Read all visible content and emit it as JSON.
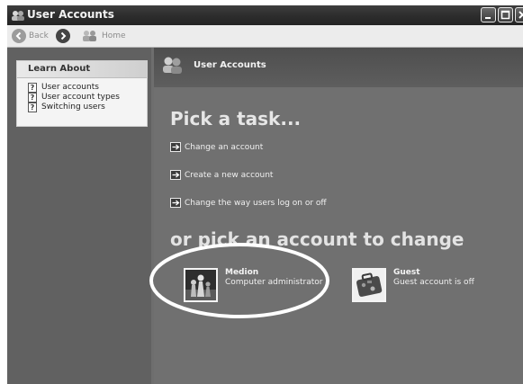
{
  "window": {
    "title": "User Accounts"
  },
  "toolbar": {
    "back_label": "Back",
    "home_label": "Home"
  },
  "learn_about": {
    "header": "Learn About",
    "items": [
      {
        "label": "User accounts",
        "icon": "help-icon"
      },
      {
        "label": "User account types",
        "icon": "help-icon"
      },
      {
        "label": "Switching users",
        "icon": "help-icon"
      }
    ]
  },
  "content": {
    "header_title": "User Accounts",
    "pick_task": "Pick a task...",
    "tasks": [
      {
        "label": "Change an account",
        "icon": "arrow-right-icon"
      },
      {
        "label": "Create a new account",
        "icon": "arrow-right-icon"
      },
      {
        "label": "Change the way users log on or off",
        "icon": "arrow-right-icon"
      }
    ],
    "pick_account": "or pick an account to change",
    "accounts": [
      {
        "name": "Medion",
        "description": "Computer administrator",
        "icon": "chess-pieces-icon",
        "highlighted": true
      },
      {
        "name": "Guest",
        "description": "Guest account is off",
        "icon": "suitcase-icon"
      }
    ]
  },
  "colors": {
    "highlight_ring": "#ffffff",
    "content_bg": "#707070",
    "sidebar_bg": "#616161"
  }
}
